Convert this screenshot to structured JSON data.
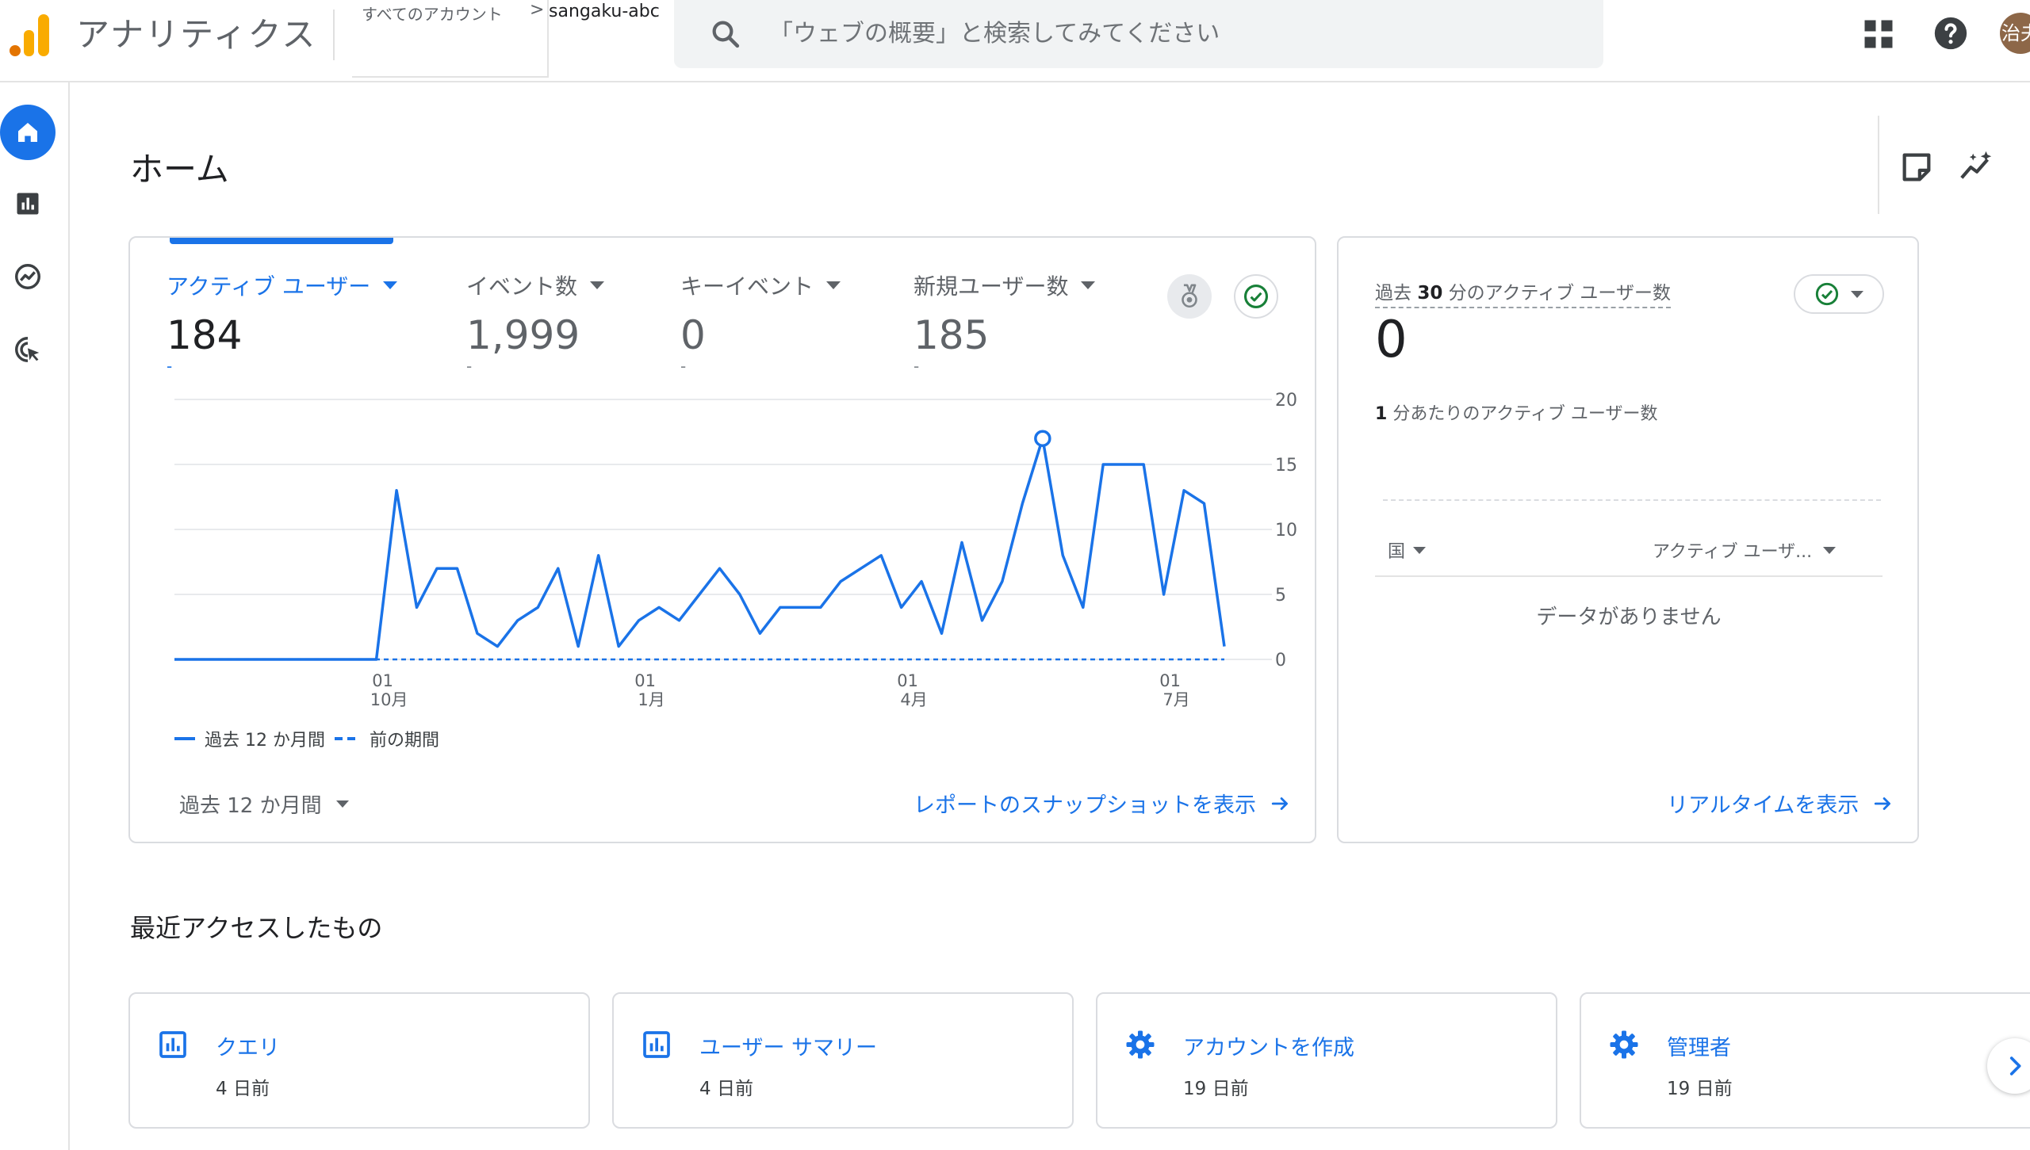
{
  "app": {
    "title": "アナリティクス",
    "breadcrumb_all": "すべてのアカウント",
    "breadcrumb_sep": ">",
    "property": "sangaku-abc",
    "search_placeholder": "「ウェブの概要」と検索してみてください",
    "avatar_text": "治夫"
  },
  "nav": [
    "home-icon",
    "reports-icon",
    "explore-icon",
    "advertising-icon"
  ],
  "page": {
    "title": "ホーム"
  },
  "metrics": [
    {
      "label": "アクティブ ユーザー",
      "value": "184",
      "change": "-"
    },
    {
      "label": "イベント数",
      "value": "1,999",
      "change": "-"
    },
    {
      "label": "キーイベント",
      "value": "0",
      "change": "-"
    },
    {
      "label": "新規ユーザー数",
      "value": "185",
      "change": "-"
    }
  ],
  "chart_data": {
    "type": "line",
    "metric": "アクティブ ユーザー",
    "ylim": [
      0,
      20
    ],
    "yticks": [
      "0",
      "5",
      "10",
      "15",
      "20"
    ],
    "xticks": [
      {
        "day": "01",
        "month": "10月"
      },
      {
        "day": "01",
        "month": "1月"
      },
      {
        "day": "01",
        "month": "4月"
      },
      {
        "day": "01",
        "month": "7月"
      }
    ],
    "grid": true,
    "legend_position": "bottom-left",
    "series": [
      {
        "name": "過去 12 か月間",
        "style": "solid",
        "values": [
          0,
          0,
          0,
          0,
          0,
          0,
          0,
          0,
          0,
          0,
          0,
          13,
          4,
          7,
          7,
          2,
          1,
          3,
          4,
          7,
          1,
          8,
          1,
          3,
          4,
          3,
          5,
          7,
          5,
          2,
          4,
          4,
          4,
          6,
          7,
          8,
          4,
          6,
          2,
          9,
          3,
          6,
          12,
          17,
          8,
          4,
          15,
          15,
          15,
          5,
          13,
          12,
          1
        ]
      },
      {
        "name": "前の期間",
        "style": "dashed",
        "values": [
          0,
          0,
          0,
          0,
          0,
          0,
          0,
          0,
          0,
          0,
          0,
          0,
          0,
          0,
          0,
          0,
          0,
          0,
          0,
          0,
          0,
          0,
          0,
          0,
          0,
          0,
          0,
          0,
          0,
          0,
          0,
          0,
          0,
          0,
          0,
          0,
          0,
          0,
          0,
          0,
          0,
          0,
          0,
          0,
          0,
          0,
          0,
          0,
          0,
          0,
          0,
          0,
          0
        ]
      }
    ],
    "highlight_index": 43
  },
  "main_card": {
    "period": "過去 12 か月間",
    "snapshot_link": "レポートのスナップショットを表示"
  },
  "realtime": {
    "title_prefix": "過去",
    "title_num": "30",
    "title_suffix": "分のアクティブ ユーザー数",
    "value": "0",
    "per_min_num": "1",
    "per_min_label": "分あたりのアクティブ ユーザー数",
    "col_country": "国",
    "col_users": "アクティブ ユーザ...",
    "empty": "データがありません",
    "link": "リアルタイムを表示"
  },
  "recent": {
    "title": "最近アクセスしたもの",
    "items": [
      {
        "name": "クエリ",
        "time": "4 日前",
        "icon": "report-icon"
      },
      {
        "name": "ユーザー サマリー",
        "time": "4 日前",
        "icon": "report-icon"
      },
      {
        "name": "アカウントを作成",
        "time": "19 日前",
        "icon": "settings-icon"
      },
      {
        "name": "管理者",
        "time": "19 日前",
        "icon": "settings-icon"
      }
    ]
  },
  "colors": {
    "accent": "#1a73e8",
    "logo_orange": "#f9ab00",
    "logo_dark": "#e37400"
  }
}
